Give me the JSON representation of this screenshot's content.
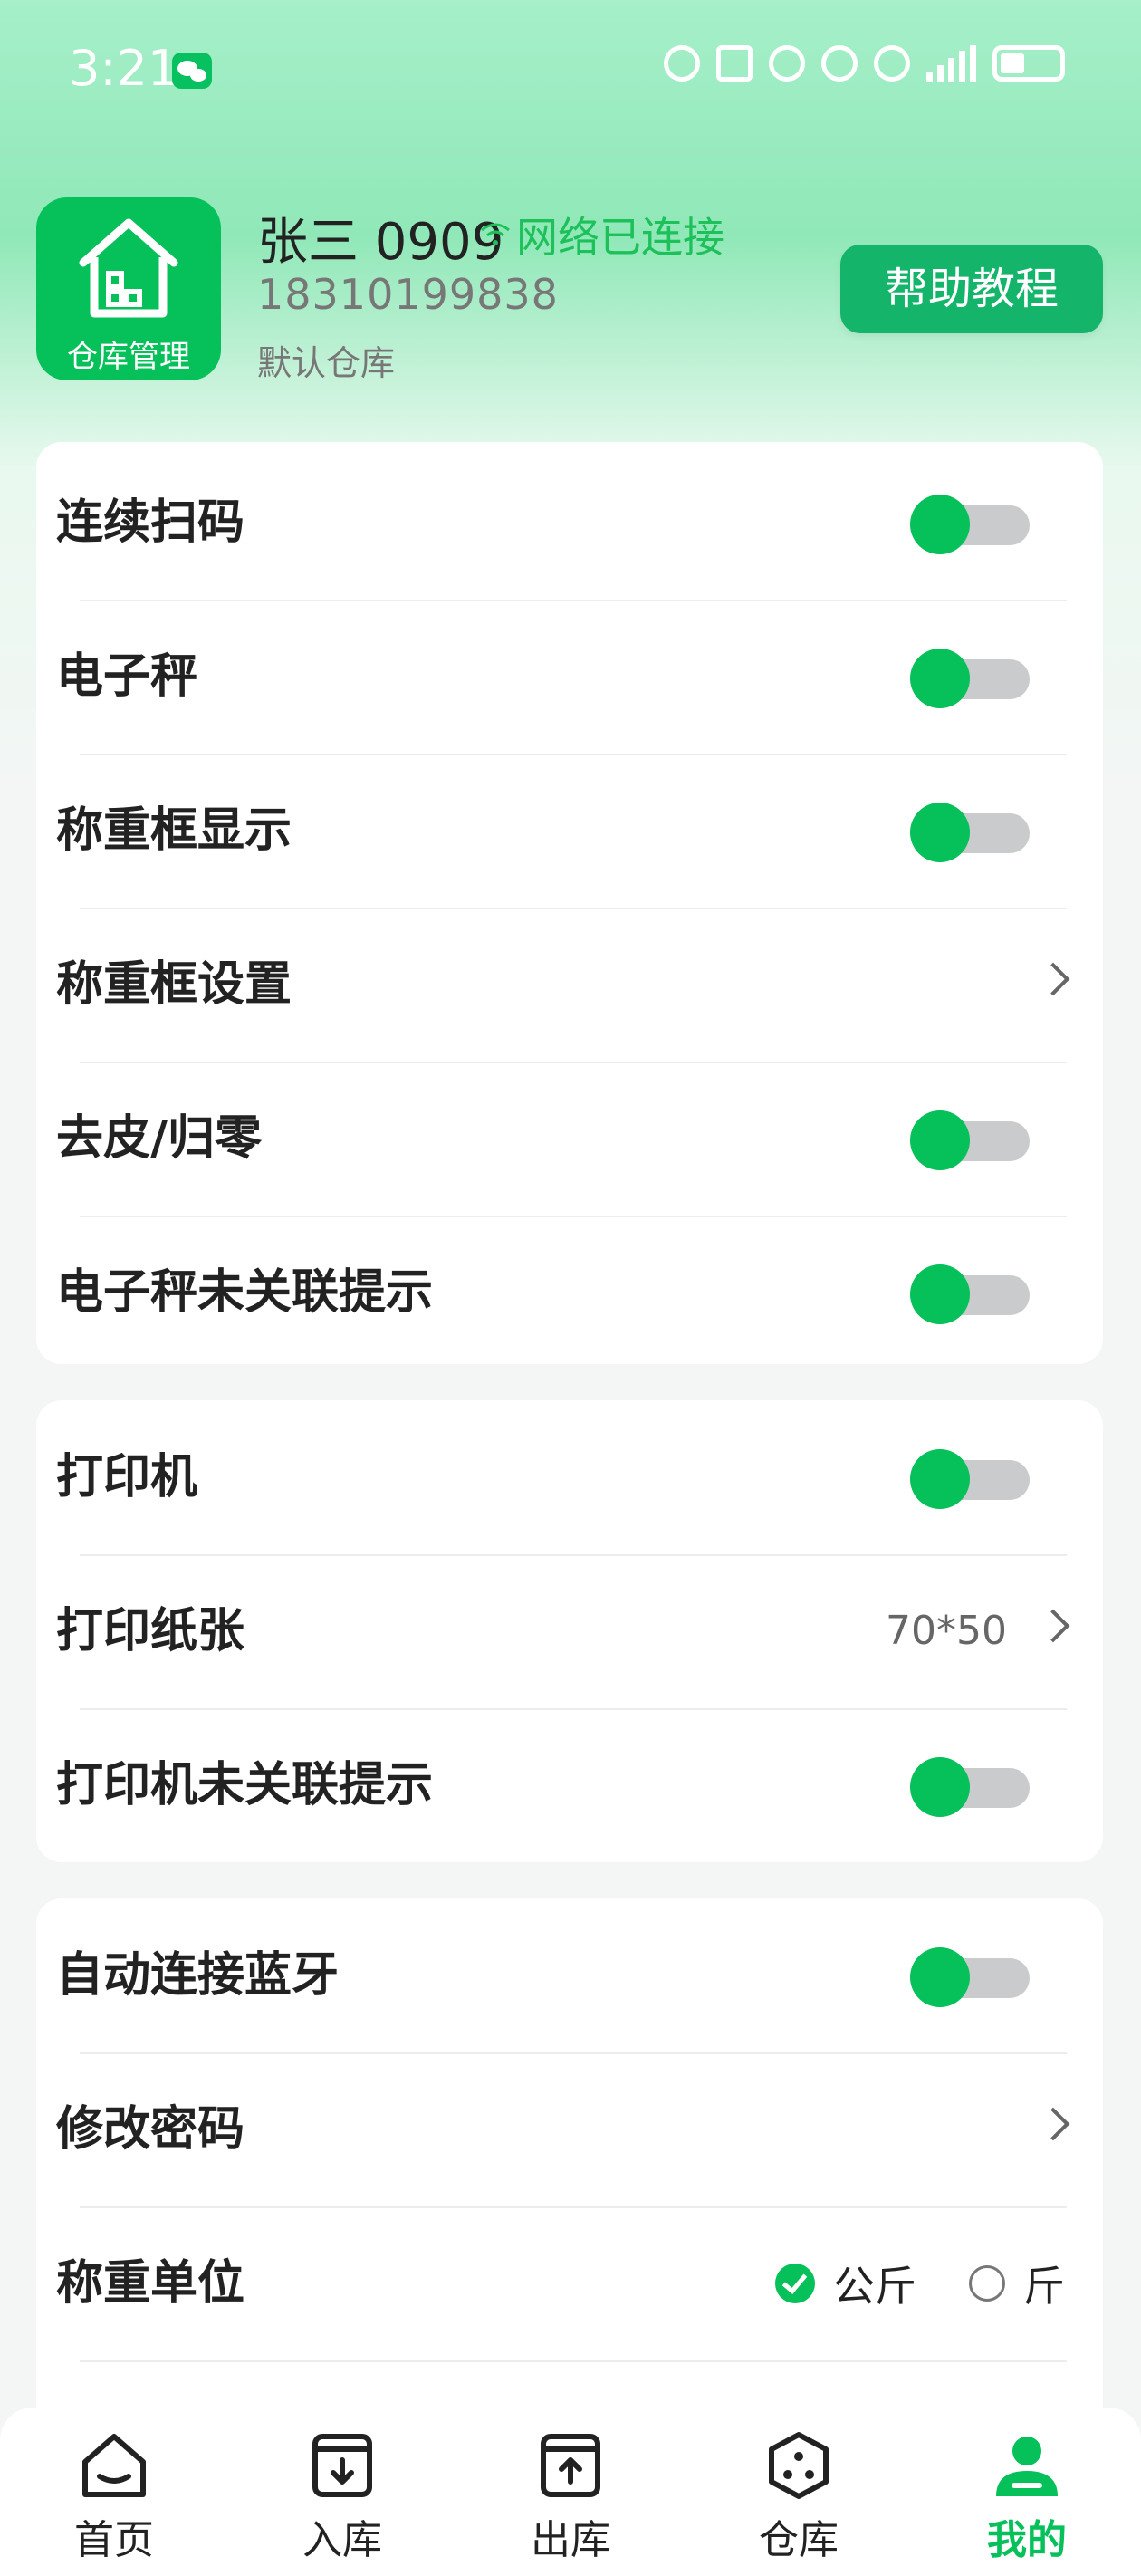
{
  "status_bar": {
    "time": "3:21"
  },
  "header": {
    "logo_label": "仓库管理",
    "user_name": "张三 0909",
    "network_status": "网络已连接",
    "phone": "18310199838",
    "warehouse": "默认仓库",
    "help_button": "帮助教程"
  },
  "card1": {
    "rows": [
      {
        "label": "连续扫码",
        "type": "toggle"
      },
      {
        "label": "电子秤",
        "type": "toggle"
      },
      {
        "label": "称重框显示",
        "type": "toggle"
      },
      {
        "label": "称重框设置",
        "type": "link"
      },
      {
        "label": "去皮/归零",
        "type": "toggle"
      },
      {
        "label": "电子秤未关联提示",
        "type": "toggle"
      }
    ]
  },
  "card2": {
    "rows": [
      {
        "label": "打印机",
        "type": "toggle"
      },
      {
        "label": "打印纸张",
        "type": "link",
        "value": "70*50"
      },
      {
        "label": "打印机未关联提示",
        "type": "toggle"
      }
    ]
  },
  "card3": {
    "rows": [
      {
        "label": "自动连接蓝牙",
        "type": "toggle"
      },
      {
        "label": "修改密码",
        "type": "link"
      },
      {
        "label": "称重单位",
        "type": "radio",
        "options": [
          "公斤",
          "斤"
        ],
        "selected": "公斤"
      }
    ]
  },
  "bottom_nav": {
    "items": [
      {
        "label": "首页",
        "icon": "home-icon"
      },
      {
        "label": "入库",
        "icon": "inbound-icon"
      },
      {
        "label": "出库",
        "icon": "outbound-icon"
      },
      {
        "label": "仓库",
        "icon": "warehouse-icon"
      },
      {
        "label": "我的",
        "icon": "profile-icon",
        "active": true
      }
    ]
  },
  "colors": {
    "accent": "#06c05a",
    "help_button": "#14b46a",
    "toggle_track": "#c9cbcc"
  }
}
